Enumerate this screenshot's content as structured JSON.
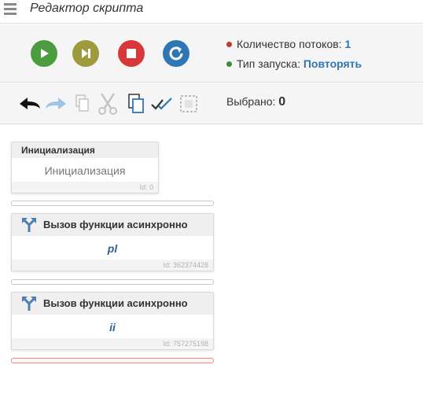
{
  "header": {
    "title": "Редактор скрипта"
  },
  "controls": {
    "buttons": [
      {
        "name": "play",
        "color": "#4a9c3f"
      },
      {
        "name": "step",
        "color": "#9e9a3e"
      },
      {
        "name": "stop",
        "color": "#d9383a"
      },
      {
        "name": "restart",
        "color": "#2f76b4"
      }
    ],
    "threads_label": "Количество потоков:",
    "threads_value": "1",
    "threads_dot_color": "#c0392b",
    "launch_label": "Тип запуска:",
    "launch_value": "Повторять",
    "launch_dot_color": "#3f8a3f"
  },
  "toolbar": {
    "tools": [
      "undo-icon",
      "redo-icon",
      "copy-icon",
      "cut-icon",
      "paste-icon",
      "select-all-icon",
      "deselect-icon"
    ],
    "selected_label": "Выбрано:",
    "selected_value": "0"
  },
  "blocks": [
    {
      "header": "Инициализация",
      "body": "Инициализация",
      "id": "Id: 0"
    },
    {
      "header": "Вызов функции асинхронно",
      "body": "pl",
      "id": "Id: 362374428"
    },
    {
      "header": "Вызов функции асинхронно",
      "body": "ii",
      "id": "Id: 757275198"
    }
  ],
  "colors": {
    "accent": "#2f76b4",
    "active_separator": "#ef8a8a"
  }
}
